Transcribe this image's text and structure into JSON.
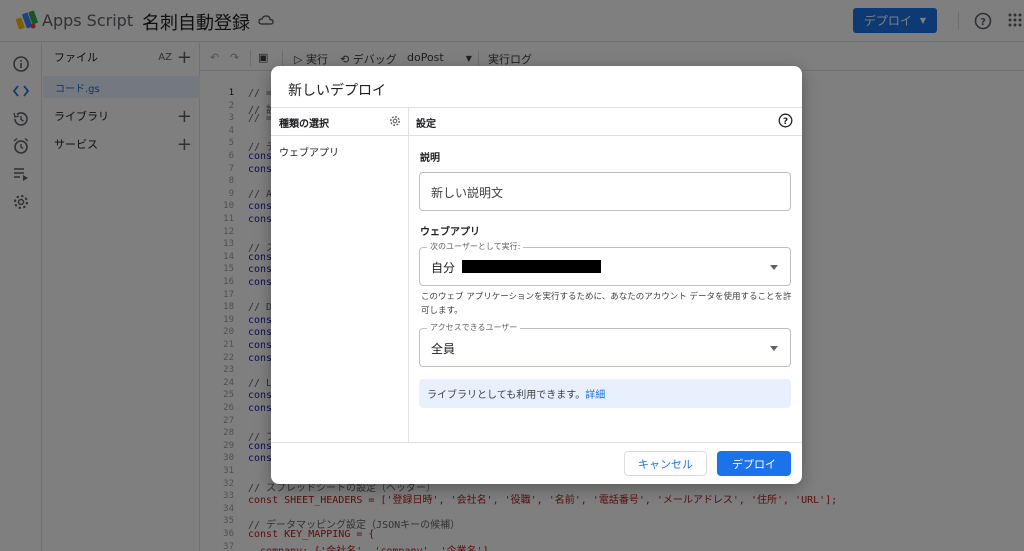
{
  "header": {
    "app_name": "Apps Script",
    "project_name": "名刺自動登録",
    "deploy_label": "デプロイ"
  },
  "files_panel": {
    "files_label": "ファイル",
    "sort_label": "AZ",
    "file_name": "コード.gs",
    "libraries_label": "ライブラリ",
    "services_label": "サービス"
  },
  "toolbar": {
    "run_label": "実行",
    "debug_label": "デバッグ",
    "function_name": "doPost",
    "log_label": "実行ログ"
  },
  "code": {
    "lines": [
      {
        "n": "1",
        "t": "// =",
        "c": "cm"
      },
      {
        "n": "2",
        "t": "// 設",
        "c": "cm"
      },
      {
        "n": "3",
        "t": "// =",
        "c": "cm"
      },
      {
        "n": "4",
        "t": "",
        "c": ""
      },
      {
        "n": "5",
        "t": "// デ",
        "c": "cm"
      },
      {
        "n": "6",
        "t": "cons",
        "c": "kw"
      },
      {
        "n": "7",
        "t": "cons",
        "c": "kw"
      },
      {
        "n": "8",
        "t": "",
        "c": ""
      },
      {
        "n": "9",
        "t": "// AI",
        "c": "cm"
      },
      {
        "n": "10",
        "t": "cons",
        "c": "kw"
      },
      {
        "n": "11",
        "t": "cons",
        "c": "kw"
      },
      {
        "n": "12",
        "t": "",
        "c": ""
      },
      {
        "n": "13",
        "t": "// ス",
        "c": "cm"
      },
      {
        "n": "14",
        "t": "cons",
        "c": "kw"
      },
      {
        "n": "15",
        "t": "cons",
        "c": "kw"
      },
      {
        "n": "16",
        "t": "cons",
        "c": "kw"
      },
      {
        "n": "17",
        "t": "",
        "c": ""
      },
      {
        "n": "18",
        "t": "// Di",
        "c": "cm"
      },
      {
        "n": "19",
        "t": "cons",
        "c": "kw"
      },
      {
        "n": "20",
        "t": "cons",
        "c": "kw"
      },
      {
        "n": "21",
        "t": "cons",
        "c": "kw"
      },
      {
        "n": "22",
        "t": "cons",
        "c": "kw"
      },
      {
        "n": "23",
        "t": "",
        "c": ""
      },
      {
        "n": "24",
        "t": "// L!",
        "c": "cm"
      },
      {
        "n": "25",
        "t": "cons",
        "c": "kw"
      },
      {
        "n": "26",
        "t": "cons",
        "c": "kw"
      },
      {
        "n": "27",
        "t": "",
        "c": ""
      },
      {
        "n": "28",
        "t": "// フ",
        "c": "cm"
      },
      {
        "n": "29",
        "t": "cons",
        "c": "kw"
      },
      {
        "n": "30",
        "t": "cons",
        "c": "kw"
      },
      {
        "n": "31",
        "t": "",
        "c": ""
      },
      {
        "n": "32",
        "t": "// スプレッドシートの設定（ヘッダー）",
        "c": "cm"
      },
      {
        "n": "33",
        "t": "const SHEET_HEADERS = ['登録日時', '会社名', '役職', '名前', '電話番号', 'メールアドレス', '住所', 'URL'];",
        "c": "mix"
      },
      {
        "n": "34",
        "t": "",
        "c": ""
      },
      {
        "n": "35",
        "t": "// データマッピング設定（JSONキーの候補）",
        "c": "cm"
      },
      {
        "n": "36",
        "t": "const KEY_MAPPING = {",
        "c": "mix2"
      },
      {
        "n": "37",
        "t": "  company: ['会社名', 'company', '企業名'],",
        "c": "mix3"
      }
    ]
  },
  "dialog": {
    "title": "新しいデプロイ",
    "type_select_label": "種類の選択",
    "settings_label": "設定",
    "type_webapp": "ウェブアプリ",
    "description_label": "説明",
    "description_placeholder": "新しい説明文",
    "webapp_section": "ウェブアプリ",
    "execute_as_legend": "次のユーザーとして実行:",
    "execute_as_value": "自分",
    "helper_text": "このウェブ アプリケーションを実行するために、あなたのアカウント データを使用することを許可します。",
    "access_legend": "アクセスできるユーザー",
    "access_value": "全員",
    "info_text": "ライブラリとしても利用できます。",
    "info_link": "詳細",
    "cancel_label": "キャンセル",
    "deploy_label": "デプロイ"
  }
}
